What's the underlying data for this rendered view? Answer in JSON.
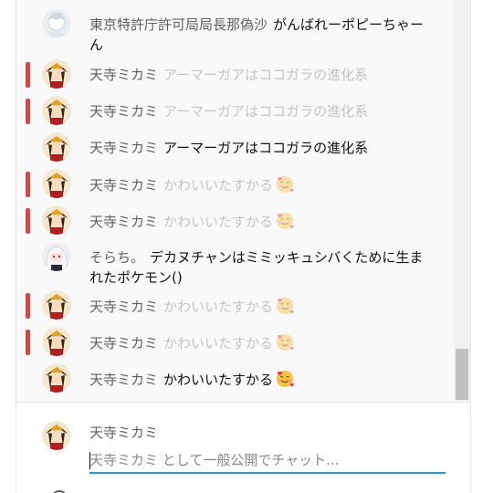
{
  "messages": [
    {
      "author": "東京特許庁許可局局長那偽沙",
      "text": "がんばれーポピーちゃーん",
      "deleted": false,
      "avatar": "ghost-girl-avatar"
    },
    {
      "author": "天寺ミカミ",
      "text": "アーマーガアはココガラの進化系",
      "deleted": true,
      "avatar": "miko-avatar"
    },
    {
      "author": "天寺ミカミ",
      "text": "アーマーガアはココガラの進化系",
      "deleted": true,
      "avatar": "miko-avatar"
    },
    {
      "author": "天寺ミカミ",
      "text": "アーマーガアはココガラの進化系",
      "deleted": false,
      "avatar": "miko-avatar"
    },
    {
      "author": "天寺ミカミ",
      "text": "かわいいたすかる",
      "deleted": true,
      "avatar": "miko-avatar",
      "emoji": "smiling-face-with-hearts"
    },
    {
      "author": "天寺ミカミ",
      "text": "かわいいたすかる",
      "deleted": true,
      "avatar": "miko-avatar",
      "emoji": "smiling-face-with-hearts"
    },
    {
      "author": "そらち。",
      "text": "デカヌチャンはミミッキュシバくために生まれたポケモン()",
      "deleted": false,
      "avatar": "white-hair-avatar"
    },
    {
      "author": "天寺ミカミ",
      "text": "かわいいたすかる",
      "deleted": true,
      "avatar": "miko-avatar",
      "emoji": "smiling-face-with-hearts"
    },
    {
      "author": "天寺ミカミ",
      "text": "かわいいたすかる",
      "deleted": true,
      "avatar": "miko-avatar",
      "emoji": "smiling-face-with-hearts"
    },
    {
      "author": "天寺ミカミ",
      "text": "かわいいたすかる",
      "deleted": false,
      "avatar": "miko-avatar",
      "emoji": "smiling-face-with-hearts"
    }
  ],
  "input": {
    "author": "天寺ミカミ",
    "placeholder": "天寺ミカミ として一般公開でチャット...",
    "value": ""
  },
  "colors": {
    "deleted_marker": "#c0504d",
    "deleted_text": "#c4c4c4",
    "author_text": "#606060",
    "input_underline": "#2793e8"
  }
}
